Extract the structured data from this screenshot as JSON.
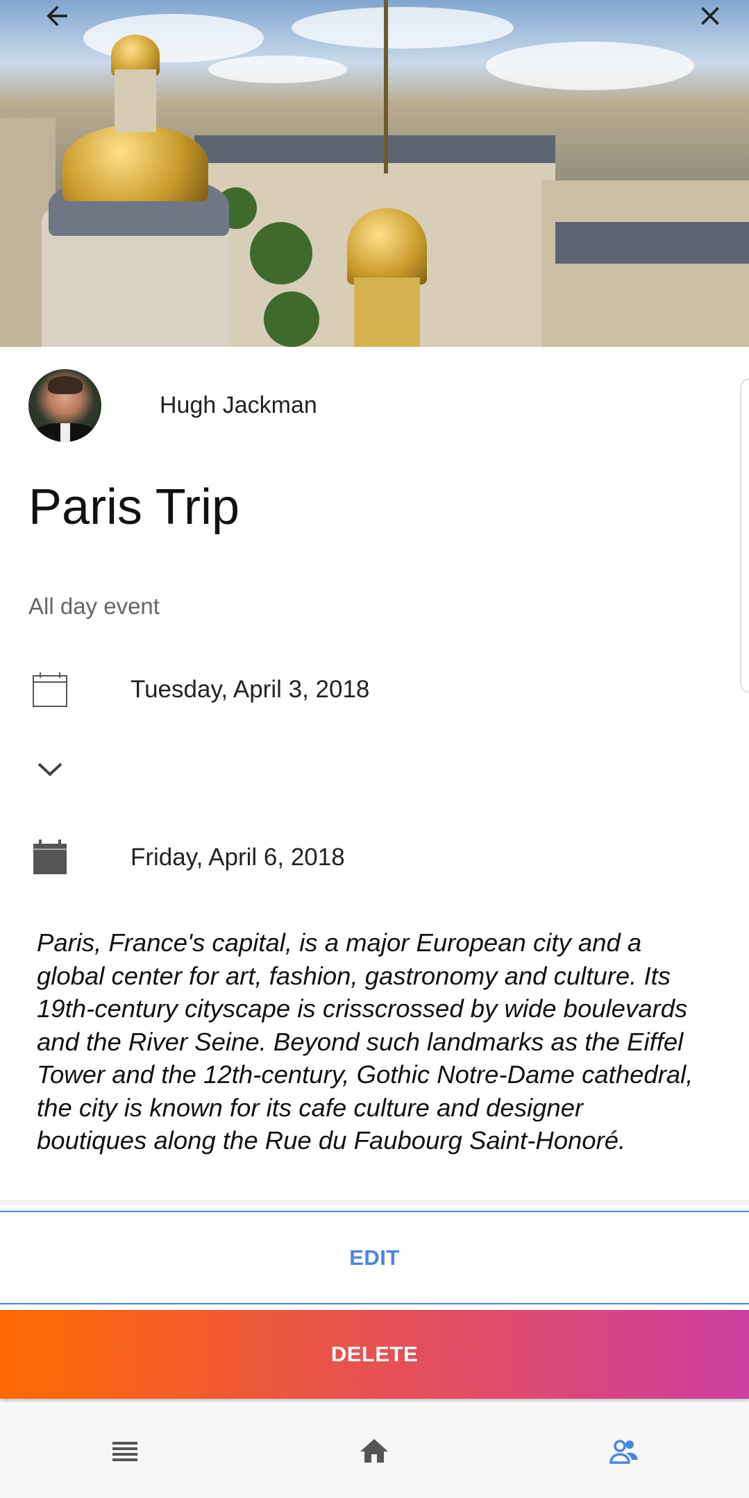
{
  "header": {
    "back_icon": "arrow-left-icon",
    "close_icon": "close-icon",
    "image_subject": "paris-rooftops-photo"
  },
  "event": {
    "author_name": "Hugh Jackman",
    "title": "Paris Trip",
    "all_day_label": "All day event",
    "start_date": "Tuesday, April 3, 2018",
    "end_date": "Friday, April 6, 2018",
    "description": "Paris, France's capital, is a major European city and a\nglobal center for art, fashion, gastronomy and culture. Its\n19th-century cityscape is crisscrossed by wide boulevards\nand the River Seine. Beyond such landmarks as the Eiffel\nTower and the 12th-century, Gothic Notre-Dame cathedral,\nthe city is known for its cafe culture and designer\nboutiques along the Rue du Faubourg Saint-Honoré."
  },
  "actions": {
    "edit_label": "EDIT",
    "delete_label": "DELETE"
  },
  "nav": {
    "items": [
      {
        "icon": "list-icon",
        "active": false
      },
      {
        "icon": "home-icon",
        "active": false
      },
      {
        "icon": "people-icon",
        "active": true
      }
    ]
  },
  "colors": {
    "accent": "#4a86e8",
    "delete_start": "#ff6a00",
    "delete_end": "#cc3ea0",
    "nav_inactive": "#555555"
  }
}
